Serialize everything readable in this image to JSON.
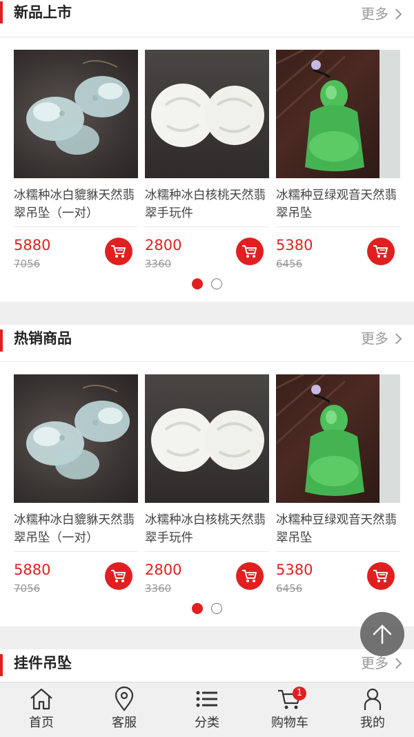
{
  "sections": [
    {
      "title": "新品上市",
      "more": "更多",
      "products": [
        {
          "name": "冰糯种冰白貔貅天然翡翠吊坠（一对）",
          "price": "5880",
          "original": "7056",
          "image": "pixiu-pendant-pair"
        },
        {
          "name": "冰糯种冰白核桃天然翡翠手玩件",
          "price": "2800",
          "original": "3360",
          "image": "walnut-handpiece"
        },
        {
          "name": "冰糯种豆绿观音天然翡翠吊坠",
          "price": "5380",
          "original": "6456",
          "image": "guanyin-pendant"
        }
      ],
      "pager": {
        "count": 2,
        "active": 0
      }
    },
    {
      "title": "热销商品",
      "more": "更多",
      "products": [
        {
          "name": "冰糯种冰白貔貅天然翡翠吊坠（一对）",
          "price": "5880",
          "original": "7056",
          "image": "pixiu-pendant-pair"
        },
        {
          "name": "冰糯种冰白核桃天然翡翠手玩件",
          "price": "2800",
          "original": "3360",
          "image": "walnut-handpiece"
        },
        {
          "name": "冰糯种豆绿观音天然翡翠吊坠",
          "price": "5380",
          "original": "6456",
          "image": "guanyin-pendant"
        }
      ],
      "pager": {
        "count": 2,
        "active": 0
      }
    },
    {
      "title": "挂件吊坠",
      "more": "更多"
    }
  ],
  "tabbar": [
    {
      "label": "首页",
      "icon": "home-icon"
    },
    {
      "label": "客服",
      "icon": "location-pin-icon"
    },
    {
      "label": "分类",
      "icon": "list-icon"
    },
    {
      "label": "购物车",
      "icon": "cart-icon",
      "badge": "1"
    },
    {
      "label": "我的",
      "icon": "user-icon"
    }
  ],
  "colors": {
    "accent": "#e02020",
    "muted": "#999999",
    "background": "#efefef"
  }
}
